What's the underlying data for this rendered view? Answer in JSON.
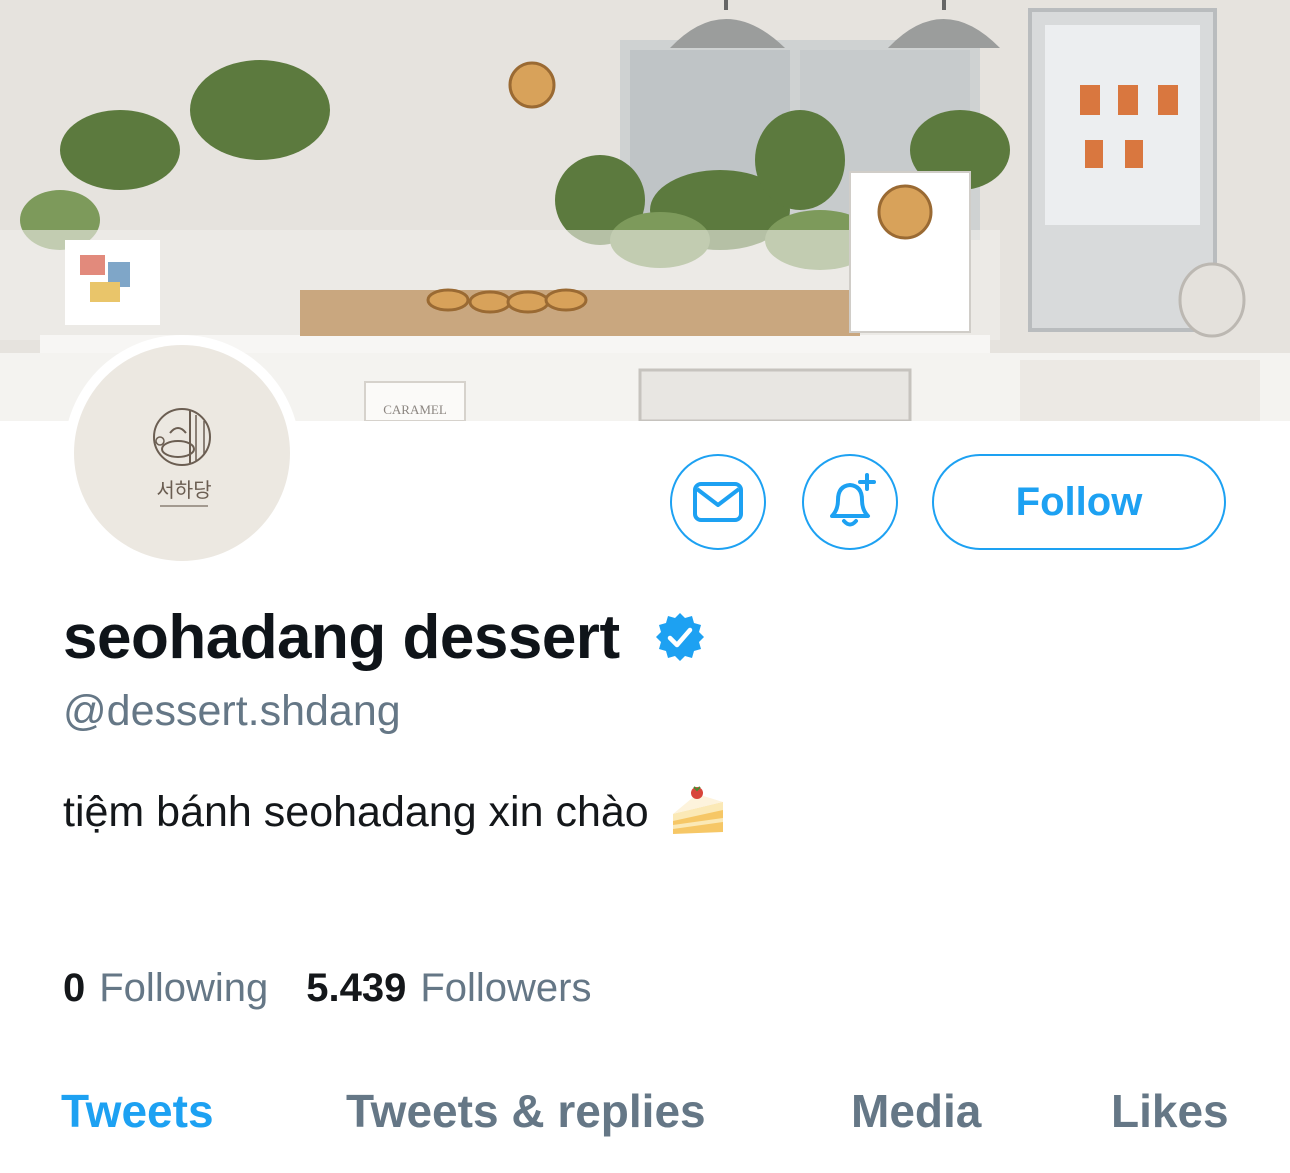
{
  "profile": {
    "display_name": "seohadang dessert",
    "verified": true,
    "handle": "@dessert.shdang",
    "bio": "tiệm bánh seohadang xin chào",
    "bio_emoji": "cake-slice-icon",
    "avatar_logo_text": "서하당"
  },
  "banner": {
    "sign_text": "CARAMEL"
  },
  "actions": {
    "message_icon": "envelope-icon",
    "notify_icon": "bell-plus-icon",
    "follow_label": "Follow"
  },
  "stats": {
    "following_count": "0",
    "following_label": "Following",
    "followers_count": "5.439",
    "followers_label": "Followers"
  },
  "tabs": [
    {
      "label": "Tweets",
      "active": true
    },
    {
      "label": "Tweets & replies",
      "active": false
    },
    {
      "label": "Media",
      "active": false
    },
    {
      "label": "Likes",
      "active": false
    }
  ],
  "colors": {
    "accent": "#1da1f2",
    "secondary_text": "#657786",
    "primary_text": "#14171a"
  }
}
